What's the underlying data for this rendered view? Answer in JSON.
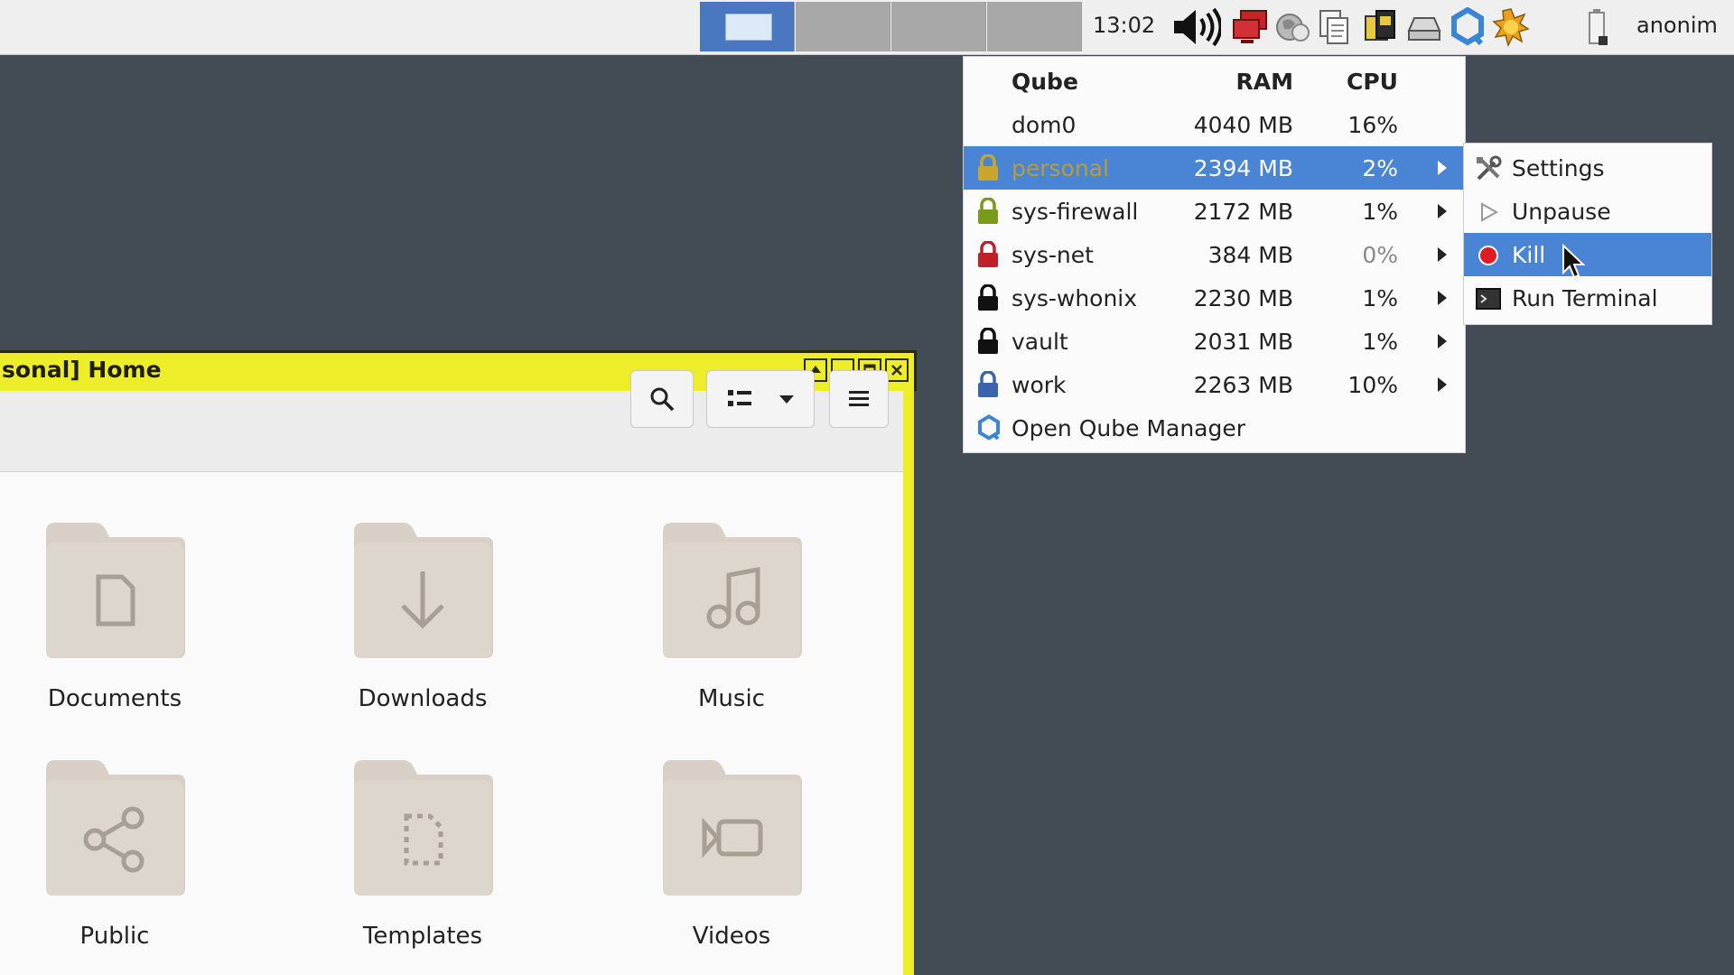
{
  "panel": {
    "clock": "13:02",
    "username": "anonim",
    "workspaces": [
      {
        "active": true
      },
      {
        "active": false
      },
      {
        "active": false
      },
      {
        "active": false
      }
    ],
    "tray_icons": [
      "red-network-icon",
      "globe-icon",
      "clipboard-icon",
      "devices-icon",
      "drive-icon",
      "qubes-icon",
      "updates-sun-icon",
      "battery-icon"
    ]
  },
  "file_manager": {
    "title": "sonal] Home",
    "folders": [
      {
        "label": "Documents",
        "icon": "document-icon"
      },
      {
        "label": "Downloads",
        "icon": "download-arrow-icon"
      },
      {
        "label": "Music",
        "icon": "music-note-icon"
      },
      {
        "label": "Public",
        "icon": "share-icon"
      },
      {
        "label": "Templates",
        "icon": "template-icon"
      },
      {
        "label": "Videos",
        "icon": "video-icon"
      }
    ]
  },
  "qubes_menu": {
    "headers": {
      "name": "Qube",
      "ram": "RAM",
      "cpu": "CPU"
    },
    "rows": [
      {
        "name": "dom0",
        "ram": "4040 MB",
        "cpu": "16%",
        "lock_color": "",
        "highlighted": false,
        "has_submenu": false
      },
      {
        "name": "personal",
        "ram": "2394 MB",
        "cpu": "2%",
        "lock_color": "#c9a52c",
        "highlighted": true,
        "has_submenu": true
      },
      {
        "name": "sys-firewall",
        "ram": "2172 MB",
        "cpu": "1%",
        "lock_color": "#7a9a1a",
        "highlighted": false,
        "has_submenu": true
      },
      {
        "name": "sys-net",
        "ram": "384 MB",
        "cpu": "0%",
        "lock_color": "#c0202a",
        "highlighted": false,
        "has_submenu": true
      },
      {
        "name": "sys-whonix",
        "ram": "2230 MB",
        "cpu": "1%",
        "lock_color": "#111111",
        "highlighted": false,
        "has_submenu": true
      },
      {
        "name": "vault",
        "ram": "2031 MB",
        "cpu": "1%",
        "lock_color": "#111111",
        "highlighted": false,
        "has_submenu": true
      },
      {
        "name": "work",
        "ram": "2263 MB",
        "cpu": "10%",
        "lock_color": "#3c63b0",
        "highlighted": false,
        "has_submenu": true
      }
    ],
    "open_manager": "Open Qube Manager"
  },
  "submenu": {
    "items": [
      {
        "label": "Settings",
        "icon": "settings-tools-icon",
        "highlighted": false
      },
      {
        "label": "Unpause",
        "icon": "play-icon",
        "highlighted": false
      },
      {
        "label": "Kill",
        "icon": "kill-red-dot-icon",
        "highlighted": true
      },
      {
        "label": "Run Terminal",
        "icon": "terminal-icon",
        "highlighted": false
      }
    ]
  },
  "colors": {
    "desktop": "#434b55",
    "highlight": "#4a84d4",
    "window_border": "#eded2a"
  }
}
